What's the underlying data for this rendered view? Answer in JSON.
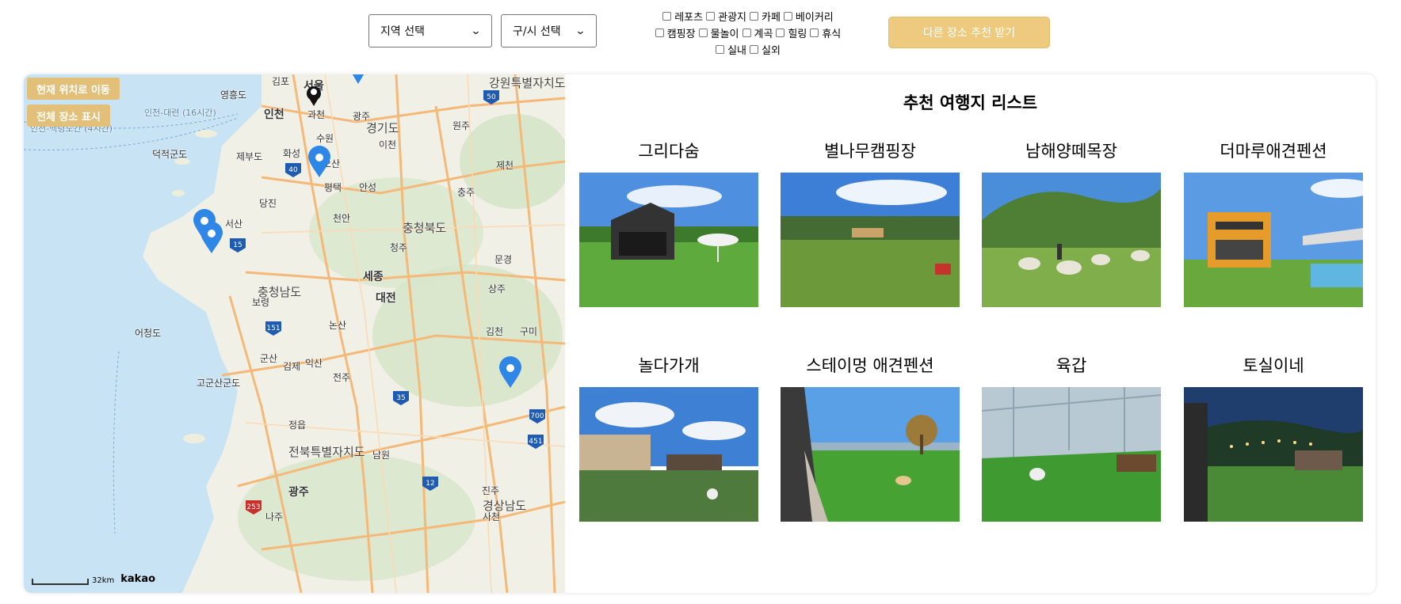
{
  "filters": {
    "region_select": "지역 선택",
    "city_select": "구/시 선택",
    "categories": [
      [
        "레포츠",
        "관광지",
        "카페",
        "베이커리"
      ],
      [
        "캠핑장",
        "물놀이",
        "계곡",
        "힐링",
        "휴식"
      ],
      [
        "실내",
        "실외"
      ]
    ],
    "recommend_button": "다른 장소 추천 받기"
  },
  "map": {
    "current_location_button": "현재 위치로 이동",
    "show_all_button": "전체 장소 표시",
    "scale_label": "32km",
    "provider": "kakao",
    "regions": [
      "강원특별자치도",
      "경기도",
      "충청북도",
      "충청남도",
      "전북특별자치도",
      "경상남도"
    ],
    "places": [
      "서울",
      "인천",
      "김포",
      "과천",
      "광주",
      "수원",
      "원주",
      "이천",
      "화성",
      "오산",
      "제천",
      "안성",
      "평택",
      "충주",
      "당진",
      "천안",
      "서산",
      "청주",
      "문경",
      "세종",
      "상주",
      "대전",
      "보령",
      "논산",
      "김천",
      "구미",
      "익산",
      "군산",
      "김제",
      "전주",
      "정읍",
      "남원",
      "진주",
      "광주",
      "나주",
      "사천",
      "영흥도",
      "덕적군도",
      "제부도",
      "어청도",
      "고군산군도"
    ],
    "route_numbers": [
      "50",
      "40",
      "15",
      "151",
      "35",
      "12",
      "253",
      "700",
      "451"
    ],
    "sea_routes": [
      "인천-대련 (16시간)",
      "인천-백령도간 (4시간)"
    ]
  },
  "list": {
    "title": "추천 여행지 리스트",
    "items": [
      {
        "name": "그리다숨"
      },
      {
        "name": "별나무캠핑장"
      },
      {
        "name": "남해양떼목장"
      },
      {
        "name": "더마루애견펜션"
      },
      {
        "name": "놀다가개"
      },
      {
        "name": "스테이멍 애견펜션"
      },
      {
        "name": "육갑"
      },
      {
        "name": "토실이네"
      }
    ]
  },
  "colors": {
    "accent": "#edca7d",
    "marker": "#2e86e6",
    "road": "#f4b978",
    "sea": "#c8e3f4"
  }
}
